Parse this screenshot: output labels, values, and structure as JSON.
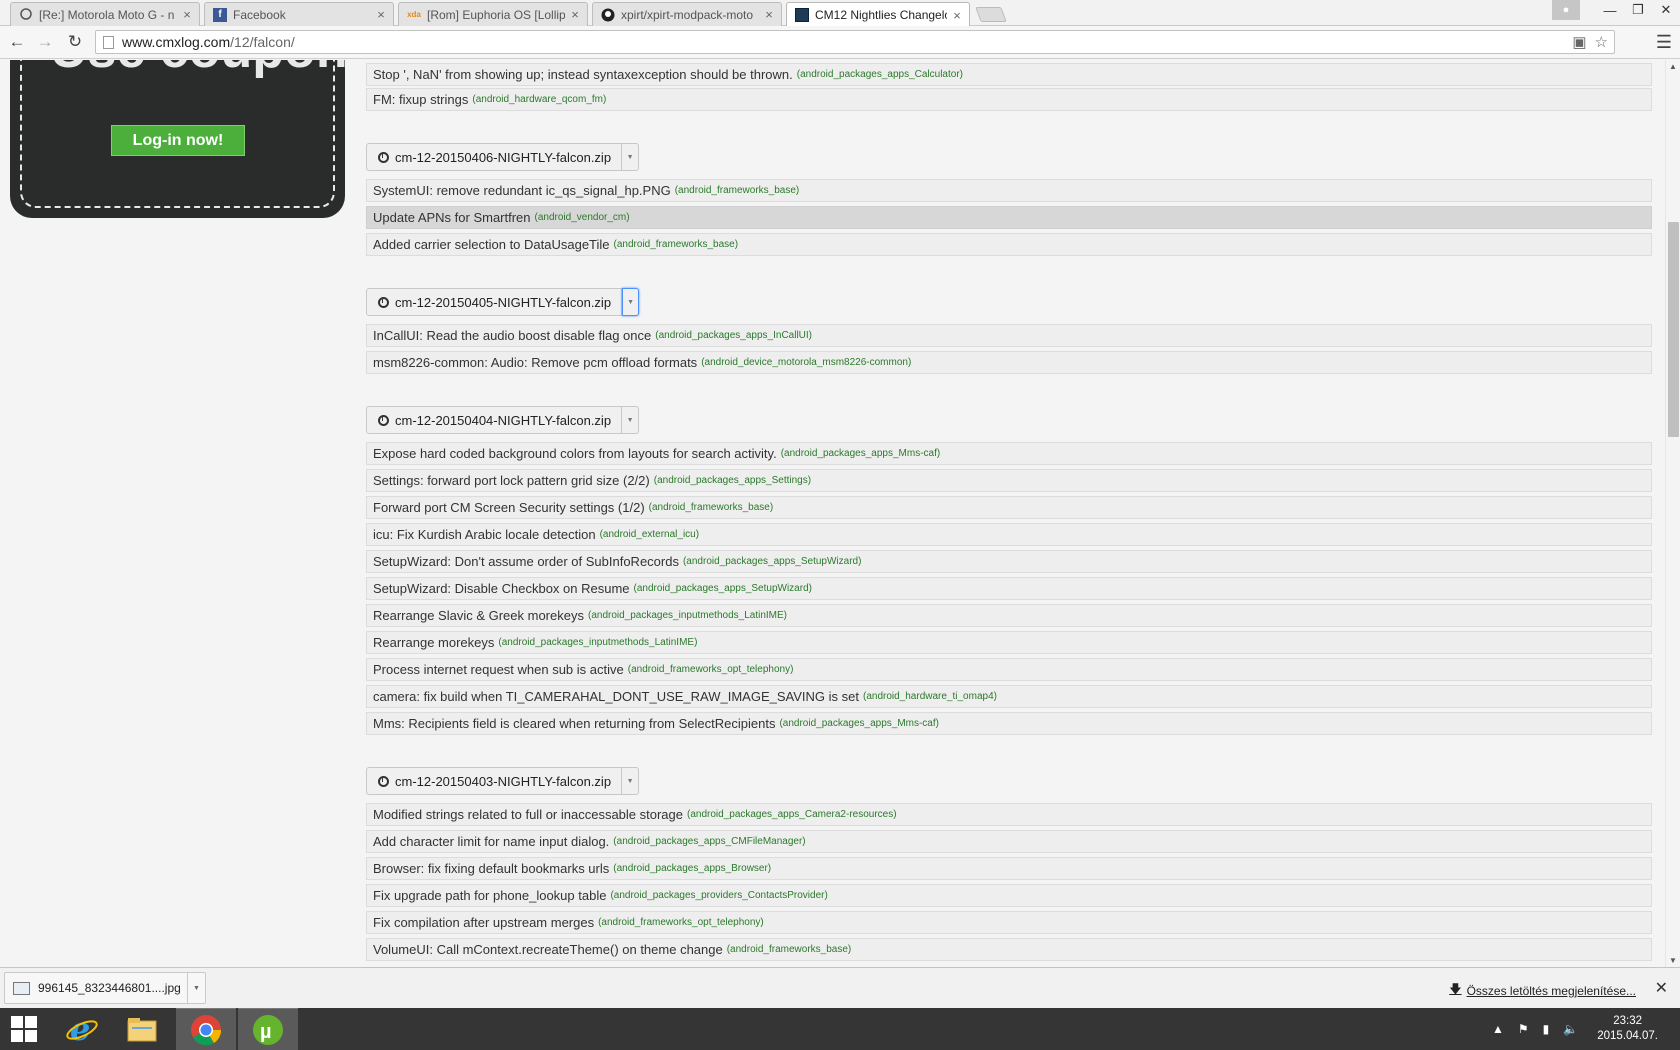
{
  "browser": {
    "tabs": [
      {
        "title": "[Re:] Motorola Moto G - n",
        "favicon": "speech-bubble-icon",
        "active": false
      },
      {
        "title": "Facebook",
        "favicon": "facebook-icon",
        "active": false
      },
      {
        "title": "[Rom] Euphoria OS [Lollip",
        "favicon": "xda-icon",
        "active": false
      },
      {
        "title": "xpirt/xpirt-modpack-moto",
        "favicon": "github-icon",
        "active": false
      },
      {
        "title": "CM12 Nightlies Changelo",
        "favicon": "cmxlog-icon",
        "active": true
      }
    ],
    "url_host": "www.cmxlog.com",
    "url_path": "/12/falcon/"
  },
  "ad": {
    "headline": "Use coupon",
    "button": "Log-in now!"
  },
  "changelog": [
    {
      "type": "change",
      "msg": "Stop ', NaN' from showing up; instead syntaxexception should be thrown.",
      "repo": "(android_packages_apps_Calculator)"
    },
    {
      "type": "change",
      "msg": "FM: fixup strings",
      "repo": "(android_hardware_qcom_fm)"
    },
    {
      "type": "build",
      "name": "cm-12-20150406-NIGHTLY-falcon.zip"
    },
    {
      "type": "change",
      "msg": "SystemUI: remove redundant ic_qs_signal_hp.PNG",
      "repo": "(android_frameworks_base)"
    },
    {
      "type": "change",
      "msg": "Update APNs for Smartfren",
      "repo": "(android_vendor_cm)",
      "hover": true
    },
    {
      "type": "change",
      "msg": "Added carrier selection to DataUsageTile",
      "repo": "(android_frameworks_base)"
    },
    {
      "type": "build",
      "name": "cm-12-20150405-NIGHTLY-falcon.zip",
      "focus": true
    },
    {
      "type": "change",
      "msg": "InCallUI: Read the audio boost disable flag once",
      "repo": "(android_packages_apps_InCallUI)"
    },
    {
      "type": "change",
      "msg": "msm8226-common: Audio: Remove pcm offload formats",
      "repo": "(android_device_motorola_msm8226-common)"
    },
    {
      "type": "build",
      "name": "cm-12-20150404-NIGHTLY-falcon.zip"
    },
    {
      "type": "change",
      "msg": "Expose hard coded background colors from layouts for search activity.",
      "repo": "(android_packages_apps_Mms-caf)"
    },
    {
      "type": "change",
      "msg": "Settings: forward port lock pattern grid size (2/2)",
      "repo": "(android_packages_apps_Settings)"
    },
    {
      "type": "change",
      "msg": "Forward port CM Screen Security settings (1/2)",
      "repo": "(android_frameworks_base)"
    },
    {
      "type": "change",
      "msg": "icu: Fix Kurdish Arabic locale detection",
      "repo": "(android_external_icu)"
    },
    {
      "type": "change",
      "msg": "SetupWizard: Don't assume order of SubInfoRecords",
      "repo": "(android_packages_apps_SetupWizard)"
    },
    {
      "type": "change",
      "msg": "SetupWizard: Disable Checkbox on Resume",
      "repo": "(android_packages_apps_SetupWizard)"
    },
    {
      "type": "change",
      "msg": "Rearrange Slavic & Greek morekeys",
      "repo": "(android_packages_inputmethods_LatinIME)"
    },
    {
      "type": "change",
      "msg": "Rearrange morekeys",
      "repo": "(android_packages_inputmethods_LatinIME)"
    },
    {
      "type": "change",
      "msg": "Process internet request when sub is active",
      "repo": "(android_frameworks_opt_telephony)"
    },
    {
      "type": "change",
      "msg": "camera: fix build when TI_CAMERAHAL_DONT_USE_RAW_IMAGE_SAVING is set",
      "repo": "(android_hardware_ti_omap4)"
    },
    {
      "type": "change",
      "msg": "Mms: Recipients field is cleared when returning from SelectRecipients",
      "repo": "(android_packages_apps_Mms-caf)"
    },
    {
      "type": "build",
      "name": "cm-12-20150403-NIGHTLY-falcon.zip"
    },
    {
      "type": "change",
      "msg": "Modified strings related to full or inaccessable storage",
      "repo": "(android_packages_apps_Camera2-resources)"
    },
    {
      "type": "change",
      "msg": "Add character limit for name input dialog.",
      "repo": "(android_packages_apps_CMFileManager)"
    },
    {
      "type": "change",
      "msg": "Browser: fix fixing default bookmarks urls",
      "repo": "(android_packages_apps_Browser)"
    },
    {
      "type": "change",
      "msg": "Fix upgrade path for phone_lookup table",
      "repo": "(android_packages_providers_ContactsProvider)"
    },
    {
      "type": "change",
      "msg": "Fix compilation after upstream merges",
      "repo": "(android_frameworks_opt_telephony)"
    },
    {
      "type": "change",
      "msg": "VolumeUI: Call mContext.recreateTheme() on theme change",
      "repo": "(android_frameworks_base)"
    }
  ],
  "downloads": {
    "file_name": "996145_8323446801....jpg",
    "show_all": "Összes letöltés megjelenítése..."
  },
  "taskbar": {
    "apps": [
      "internet-explorer-icon",
      "file-explorer-icon",
      "chrome-icon",
      "utorrent-icon"
    ],
    "time": "23:32",
    "date": "2015.04.07."
  },
  "colors": {
    "repo_green": "#2b7a2b",
    "ad_button_green": "#4caf3c",
    "taskbar_bg": "#353535"
  }
}
